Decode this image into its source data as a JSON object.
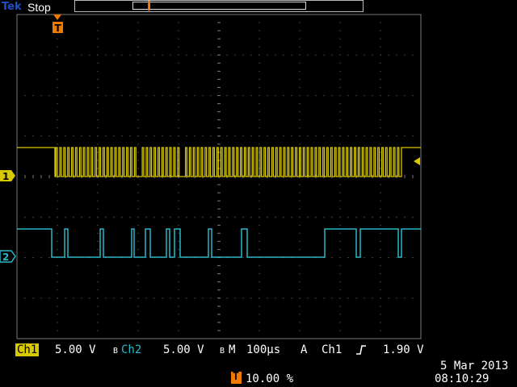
{
  "header": {
    "brand": "Tek",
    "status": "Stop"
  },
  "markers": {
    "trigger_label": "T",
    "ch1_label": "1",
    "ch2_label": "2"
  },
  "channels": {
    "ch1": {
      "name": "Ch1",
      "scale": "5.00 V",
      "color": "#d8c800"
    },
    "ch2": {
      "name": "Ch2",
      "scale": "5.00 V",
      "color": "#29b8c8"
    }
  },
  "timebase": {
    "bw_mark": "B",
    "mode_label": "M",
    "scale": "100µs"
  },
  "trigger": {
    "mode": "A",
    "source": "Ch1",
    "slope_icon": "rising-edge-icon",
    "level": "1.90 V",
    "position": "10.00 %"
  },
  "datetime": {
    "date": "5 Mar  2013",
    "time": "08:10:29"
  },
  "colors": {
    "grid": "#7a7a7a",
    "ch1": "#d8c800",
    "ch2": "#29b8c8",
    "trigger": "#f07a00"
  }
}
